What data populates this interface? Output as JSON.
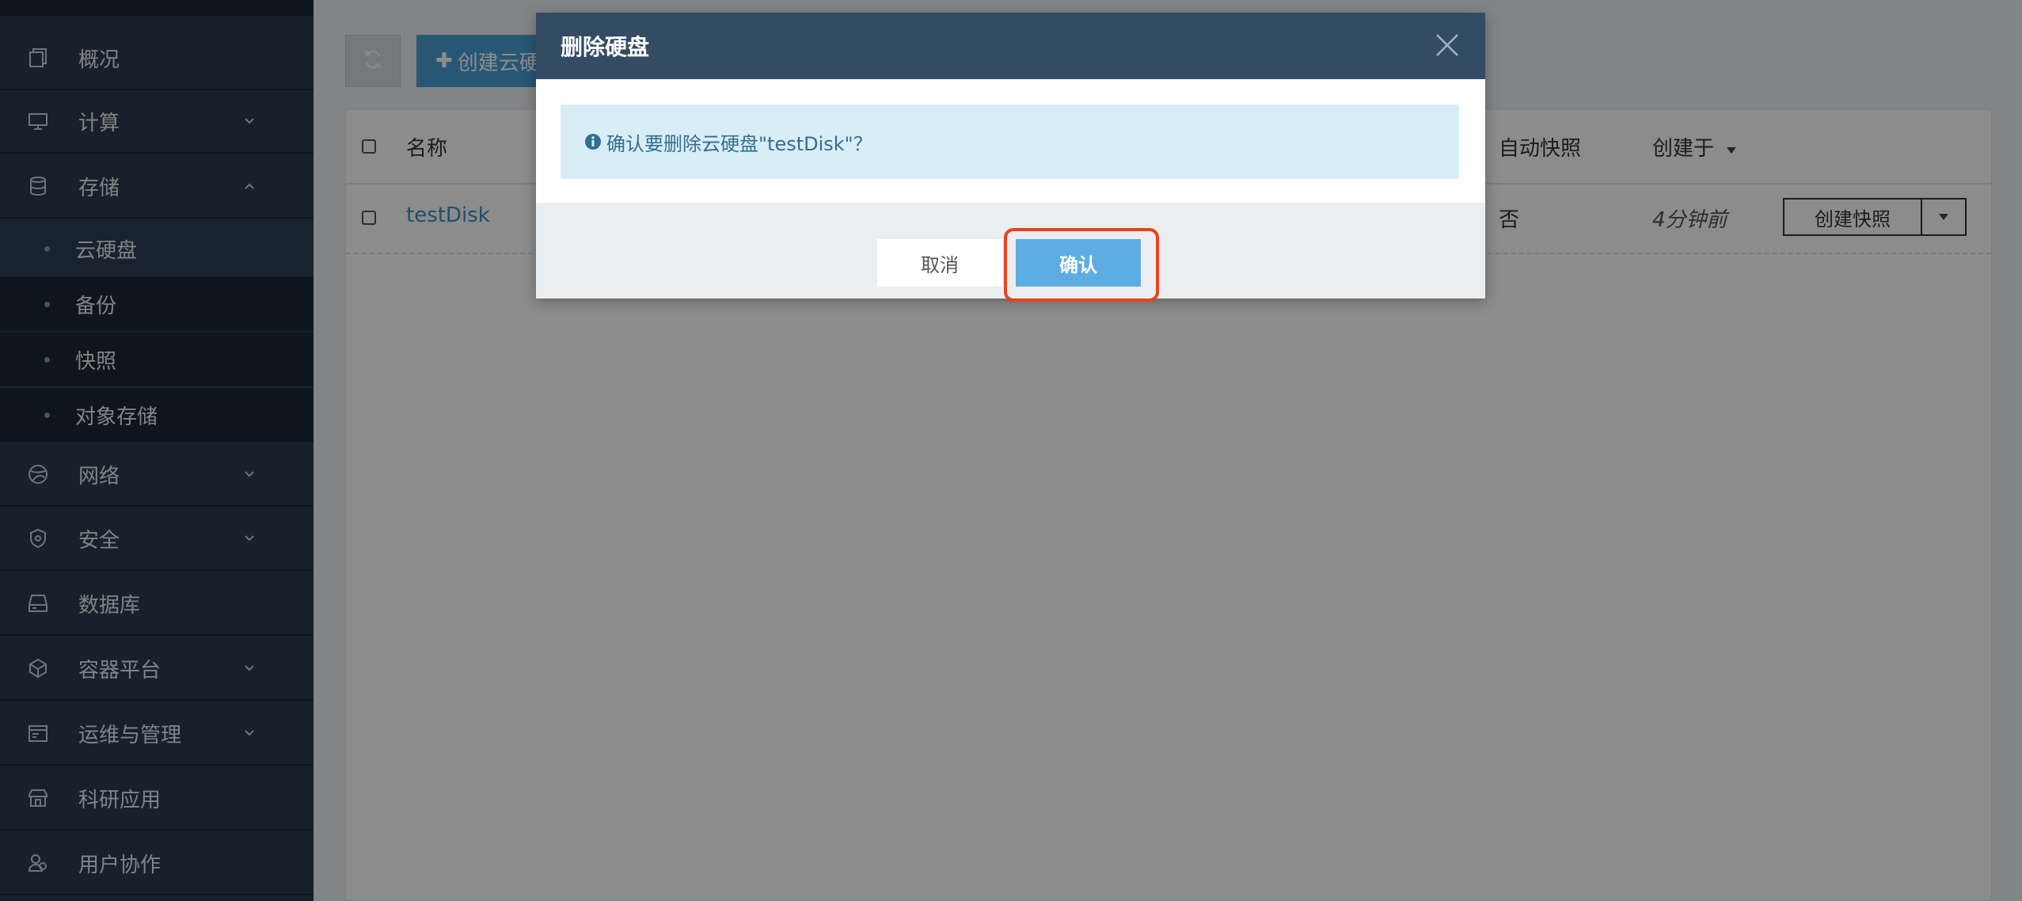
{
  "sidebar": {
    "items": [
      {
        "label": "概况",
        "icon": "copy-icon",
        "expandable": false
      },
      {
        "label": "计算",
        "icon": "monitor-icon",
        "expandable": true
      },
      {
        "label": "存储",
        "icon": "database-icon",
        "expandable": true,
        "expanded": true
      },
      {
        "label": "网络",
        "icon": "globe-icon",
        "expandable": true
      },
      {
        "label": "安全",
        "icon": "shield-icon",
        "expandable": true
      },
      {
        "label": "数据库",
        "icon": "drive-icon",
        "expandable": false
      },
      {
        "label": "容器平台",
        "icon": "cube-icon",
        "expandable": true
      },
      {
        "label": "运维与管理",
        "icon": "calendar-icon",
        "expandable": true
      },
      {
        "label": "科研应用",
        "icon": "store-icon",
        "expandable": false
      },
      {
        "label": "用户协作",
        "icon": "users-icon",
        "expandable": false
      }
    ],
    "storage_sub": [
      {
        "label": "云硬盘",
        "active": true
      },
      {
        "label": "备份"
      },
      {
        "label": "快照"
      },
      {
        "label": "对象存储"
      }
    ]
  },
  "toolbar": {
    "refresh_icon": "refresh-icon",
    "create_label": "创建云硬"
  },
  "table": {
    "headers": {
      "name": "名称",
      "auto_snapshot": "自动快照",
      "created_at": "创建于"
    },
    "rows": [
      {
        "name": "testDisk",
        "auto_snapshot": "否",
        "created_at": "4分钟前",
        "action_label": "创建快照"
      }
    ]
  },
  "modal": {
    "title": "删除硬盘",
    "message": "确认要删除云硬盘\"testDisk\"？",
    "cancel_label": "取消",
    "confirm_label": "确认"
  },
  "colors": {
    "sidebar_bg": "#2c3d4f",
    "modal_header": "#344c63",
    "confirm_btn": "#5dade2",
    "highlight": "#e8431f",
    "alert_bg": "#d9edf7"
  }
}
